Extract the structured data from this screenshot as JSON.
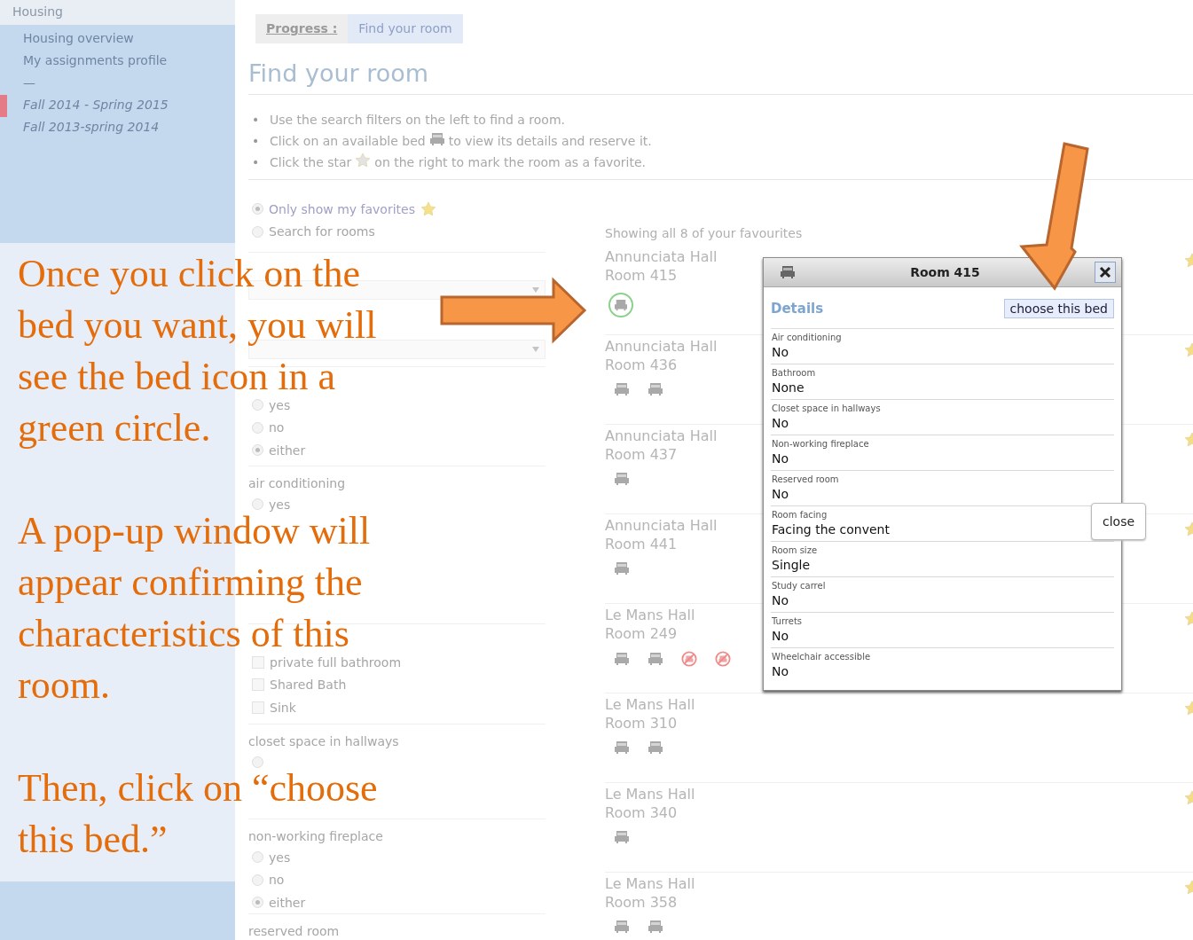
{
  "sidebar": {
    "header": "Housing",
    "items": [
      {
        "label": "Housing overview",
        "kind": "link",
        "selected": false
      },
      {
        "label": "My assignments profile",
        "kind": "link",
        "selected": false
      },
      {
        "label": "—",
        "kind": "separator",
        "selected": false
      },
      {
        "label": "Fall 2014 - Spring 2015",
        "kind": "term",
        "selected": true
      },
      {
        "label": "Fall 2013-spring 2014",
        "kind": "term",
        "selected": false
      }
    ]
  },
  "breadcrumb": [
    {
      "label": "Progress :",
      "kind": "heading"
    },
    {
      "label": "Find your room",
      "kind": "step"
    }
  ],
  "title": "Find your room",
  "instructions": [
    {
      "marker": "•",
      "kind": "plain",
      "before": "Use the search filters on the left to find a room."
    },
    {
      "marker": "•",
      "kind": "bed",
      "before": "Click on an available bed",
      "after": "to view its details and reserve it."
    },
    {
      "marker": "•",
      "kind": "star",
      "before": "Click the star",
      "after": "on the right to mark the room as a favorite."
    }
  ],
  "view_options": [
    {
      "label": "Only show my favorites",
      "selected": true,
      "star": true
    },
    {
      "label": "Search for rooms",
      "selected": false,
      "star": false
    }
  ],
  "filters": [
    {
      "kind": "selects",
      "selects": [
        {
          "kind": "dropdown"
        },
        {
          "kind": "dropdown"
        }
      ]
    },
    {
      "kind": "radios",
      "options": [
        {
          "label": "yes",
          "selected": false
        },
        {
          "label": "no",
          "selected": false
        },
        {
          "label": "either",
          "selected": true
        }
      ]
    },
    {
      "kind": "radios",
      "title": "air conditioning",
      "options": [
        {
          "label": "yes",
          "selected": false
        }
      ]
    },
    {
      "kind": "checks",
      "options": [
        {
          "label": "private full bathroom",
          "checked": false
        },
        {
          "label": "Shared Bath",
          "checked": false
        },
        {
          "label": "Sink",
          "checked": false
        }
      ]
    },
    {
      "kind": "radios",
      "title": "closet space in hallways",
      "options": [
        {
          "selected": false
        }
      ]
    },
    {
      "kind": "radios",
      "title": "non-working fireplace",
      "options": [
        {
          "label": "yes",
          "selected": false
        },
        {
          "label": "no",
          "selected": false
        },
        {
          "label": "either",
          "selected": true
        }
      ]
    },
    {
      "kind": "radios",
      "title": "reserved room"
    }
  ],
  "results": {
    "summary": "Showing all 8 of your favourites",
    "rooms": [
      {
        "hall": "Annunciata Hall",
        "room": "Room 415",
        "beds": [
          {
            "kind": "chosen"
          }
        ],
        "favorite": true
      },
      {
        "hall": "Annunciata Hall",
        "room": "Room 436",
        "beds": [
          {
            "kind": "free"
          },
          {
            "kind": "free"
          }
        ],
        "favorite": true
      },
      {
        "hall": "Annunciata Hall",
        "room": "Room 437",
        "beds": [
          {
            "kind": "free"
          }
        ],
        "favorite": true
      },
      {
        "hall": "Annunciata Hall",
        "room": "Room 441",
        "beds": [
          {
            "kind": "free"
          }
        ],
        "favorite": true
      },
      {
        "hall": "Le Mans Hall",
        "room": "Room 249",
        "beds": [
          {
            "kind": "free"
          },
          {
            "kind": "free"
          },
          {
            "kind": "taken"
          },
          {
            "kind": "taken"
          }
        ],
        "favorite": true
      },
      {
        "hall": "Le Mans Hall",
        "room": "Room 310",
        "beds": [
          {
            "kind": "free"
          },
          {
            "kind": "free"
          }
        ],
        "favorite": true
      },
      {
        "hall": "Le Mans Hall",
        "room": "Room 340",
        "beds": [
          {
            "kind": "free"
          }
        ],
        "favorite": true
      },
      {
        "hall": "Le Mans Hall",
        "room": "Room 358",
        "beds": [
          {
            "kind": "free"
          },
          {
            "kind": "free"
          }
        ],
        "favorite": true
      }
    ]
  },
  "popup": {
    "title": "Room 415",
    "section": "Details",
    "action": "choose this bed",
    "fields": [
      {
        "label": "Air conditioning",
        "value": "No"
      },
      {
        "label": "Bathroom",
        "value": "None"
      },
      {
        "label": "Closet space in hallways",
        "value": "No"
      },
      {
        "label": "Non-working fireplace",
        "value": "No"
      },
      {
        "label": "Reserved room",
        "value": "No"
      },
      {
        "label": "Room facing",
        "value": "Facing the convent"
      },
      {
        "label": "Room size",
        "value": "Single"
      },
      {
        "label": "Study carrel",
        "value": "No"
      },
      {
        "label": "Turrets",
        "value": "No"
      },
      {
        "label": "Wheelchair accessible",
        "value": "No"
      }
    ],
    "tooltip": "close"
  },
  "annotation": {
    "paragraphs": [
      {
        "lines": [
          "Once you click on the",
          "bed you want, you will",
          "see the bed icon in a",
          "green circle."
        ]
      },
      {
        "lines": [
          "A pop-up window will",
          "appear confirming the",
          "characteristics of this",
          "room."
        ]
      },
      {
        "lines": [
          "Then, click on “choose",
          "this bed.”"
        ]
      }
    ]
  }
}
